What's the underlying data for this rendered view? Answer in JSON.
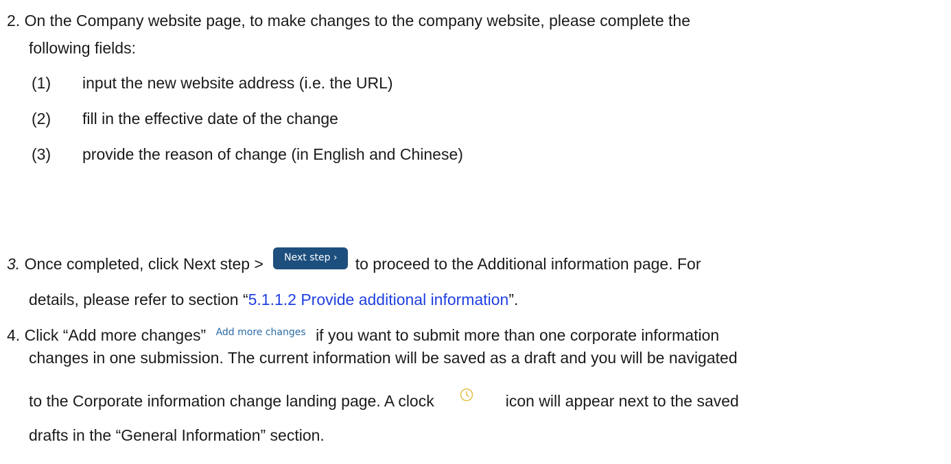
{
  "step2": {
    "number": "2.",
    "text_line1": "On the Company website page, to make changes to the company website, please complete the",
    "text_line2": "following fields:",
    "items": [
      {
        "marker": "(1)",
        "text": "input the new website address (i.e. the URL)"
      },
      {
        "marker": "(2)",
        "text": "fill in the effective date of the change"
      },
      {
        "marker": "(3)",
        "text": "provide the reason of change (in English and Chinese)"
      }
    ]
  },
  "step3": {
    "number": "3.",
    "text_before": "Once completed, click Next step >",
    "button_label": "Next step ›",
    "text_after": "to proceed to the Additional information page. For",
    "line2_before": "details, please refer to section “",
    "link_text": "5.1.1.2 Provide additional information",
    "line2_after": "”."
  },
  "step4": {
    "number": "4.",
    "text_before": "Click “Add more changes”",
    "add_more_label": "Add more changes",
    "text_after": "if you want to submit more than one corporate information",
    "line2": "changes in one submission. The current information will be saved as a draft and you will be navigated",
    "line3_before": "to the Corporate information change landing page. A clock",
    "line3_after": "icon will appear next to the saved",
    "line4": "drafts in the “General Information” section.",
    "clock_icon": "clock-icon",
    "clock_color": "#e3c14a"
  },
  "colors": {
    "link": "#1f3fe0",
    "button_bg": "#1d4f7e",
    "add_more_text": "#2b6aa6"
  }
}
